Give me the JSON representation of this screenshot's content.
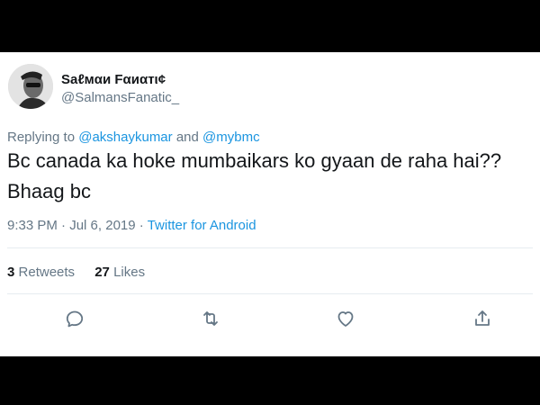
{
  "tweet": {
    "author": {
      "display_name": "Saℓмαи Fαиαтι¢",
      "handle": "@SalmansFanatic_"
    },
    "replying": {
      "prefix": "Replying to",
      "mention1": "@akshaykumar",
      "conjunction": "and",
      "mention2": "@mybmc"
    },
    "text_line1": "Bc canada ka hoke mumbaikars ko gyaan de raha hai??",
    "text_line2": "Bhaag bc",
    "meta": {
      "time": "9:33 PM",
      "separator": "·",
      "date": "Jul 6, 2019",
      "source": "Twitter for Android"
    },
    "stats": {
      "retweets_count": "3",
      "retweets_label": "Retweets",
      "likes_count": "27",
      "likes_label": "Likes"
    },
    "actions": [
      {
        "icon": "reply-icon"
      },
      {
        "icon": "retweet-icon"
      },
      {
        "icon": "like-icon"
      },
      {
        "icon": "share-icon"
      }
    ]
  },
  "colors": {
    "link": "#1b95e0",
    "secondary": "#657786",
    "primary_text": "#14171a",
    "divider": "#e6ecf0"
  }
}
